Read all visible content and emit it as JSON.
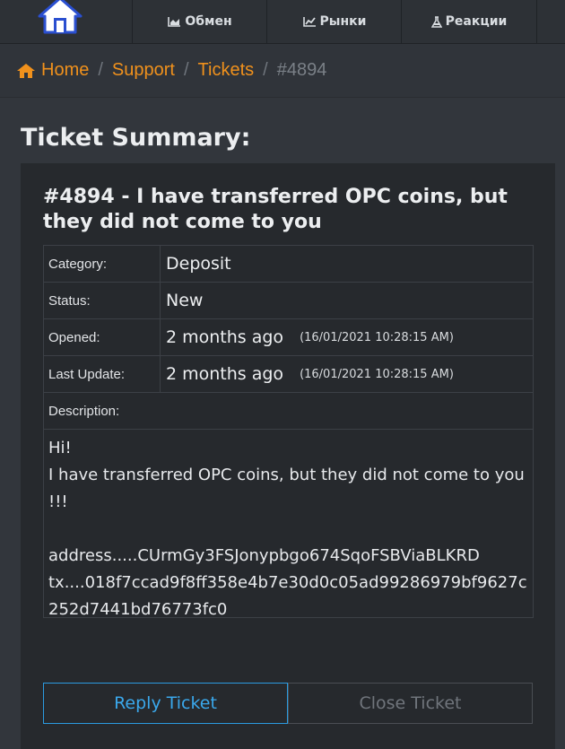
{
  "nav": {
    "items": [
      {
        "label": "Обмен",
        "icon": "area-chart-icon"
      },
      {
        "label": "Рынки",
        "icon": "line-chart-icon"
      },
      {
        "label": "Реакции",
        "icon": "flask-icon"
      }
    ]
  },
  "breadcrumb": {
    "home": "Home",
    "support": "Support",
    "tickets": "Tickets",
    "current": "#4894"
  },
  "page_title": "Ticket Summary:",
  "ticket": {
    "title": "#4894 - I have transferred OPC coins, but they did not come to you",
    "category_label": "Category:",
    "category": "Deposit",
    "status_label": "Status:",
    "status": "New",
    "opened_label": "Opened:",
    "opened": "2 months ago",
    "opened_stamp": "(16/01/2021 10:28:15 AM)",
    "updated_label": "Last Update:",
    "updated": "2 months ago",
    "updated_stamp": "(16/01/2021 10:28:15 AM)",
    "description_label": "Description:",
    "description_lines": [
      "Hi!",
      "I have transferred OPC coins, but they did not come to you !!!",
      "",
      "address.....CUrmGy3FSJonypbgo674SqoFSBViaBLKRD",
      "tx....018f7ccad9f8ff358e4b7e30d0c05ad99286979bf9627c252d7441bd76773fc0"
    ]
  },
  "actions": {
    "reply": "Reply Ticket",
    "close": "Close Ticket"
  },
  "colors": {
    "accent": "#f0911c",
    "primary": "#2b9be0",
    "background": "#32363c"
  }
}
